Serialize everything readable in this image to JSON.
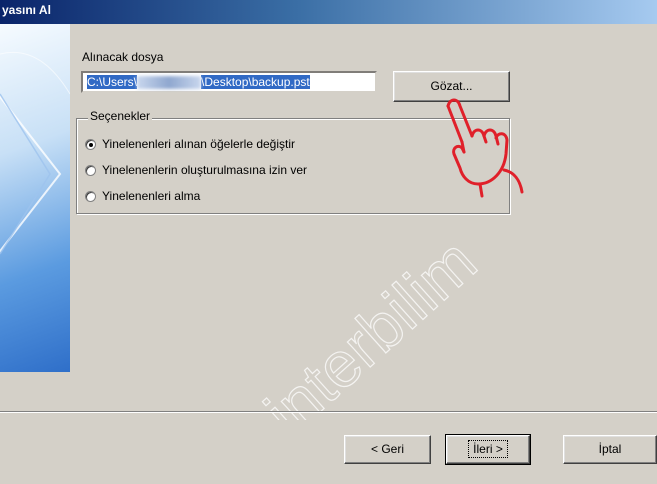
{
  "window": {
    "title": "Aktarımı Yapılandırma Dosyasını Al",
    "title_visible": "yasını Al"
  },
  "file": {
    "label": "Alınacak dosya",
    "path_prefix": "C:\\Users\\",
    "path_suffix": "\\Desktop\\backup.pst",
    "browse_label": "Gözat..."
  },
  "options": {
    "legend": "Seçenekler",
    "items": [
      {
        "label": "Yinelenenleri alınan öğelerle değiştir",
        "selected": true
      },
      {
        "label": "Yinelenenlerin oluşturulmasına izin ver",
        "selected": false
      },
      {
        "label": "Yinelenenleri alma",
        "selected": false
      }
    ]
  },
  "footer": {
    "back_label": "< Geri",
    "next_label": "İleri >",
    "cancel_label": "İptal"
  },
  "watermark": {
    "text": "interbilim"
  },
  "colors": {
    "titlebar_start": "#0a246a",
    "titlebar_end": "#a6caf0",
    "dialog_bg": "#d4d0c8",
    "selection": "#316ac5",
    "hand_cursor": "#e0202a"
  },
  "icons": {
    "cursor": "pointing-hand-icon"
  }
}
